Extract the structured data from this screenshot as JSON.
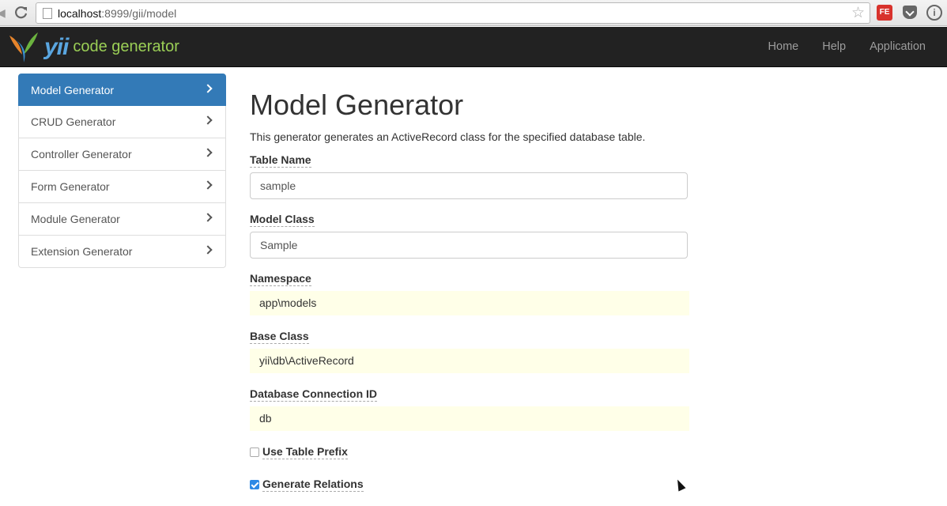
{
  "browser": {
    "url_host": "localhost",
    "url_rest": ":8999/gii/model"
  },
  "navbar": {
    "brand_yii": "yii",
    "brand_text": "code generator",
    "links": [
      "Home",
      "Help",
      "Application"
    ]
  },
  "sidebar": {
    "items": [
      {
        "label": "Model Generator",
        "active": true
      },
      {
        "label": "CRUD Generator",
        "active": false
      },
      {
        "label": "Controller Generator",
        "active": false
      },
      {
        "label": "Form Generator",
        "active": false
      },
      {
        "label": "Module Generator",
        "active": false
      },
      {
        "label": "Extension Generator",
        "active": false
      }
    ]
  },
  "main": {
    "title": "Model Generator",
    "description": "This generator generates an ActiveRecord class for the specified database table.",
    "fields": {
      "table_name": {
        "label": "Table Name",
        "value": "sample"
      },
      "model_class": {
        "label": "Model Class",
        "value": "Sample"
      },
      "namespace": {
        "label": "Namespace",
        "value": "app\\models"
      },
      "base_class": {
        "label": "Base Class",
        "value": "yii\\db\\ActiveRecord"
      },
      "db_connection": {
        "label": "Database Connection ID",
        "value": "db"
      }
    },
    "checkboxes": {
      "use_table_prefix": {
        "label": "Use Table Prefix",
        "checked": false
      },
      "generate_relations": {
        "label": "Generate Relations",
        "checked": true
      }
    }
  },
  "colors": {
    "navbar_bg": "#222222",
    "active_item": "#337ab7",
    "sticky_field_bg": "#ffffe8"
  }
}
